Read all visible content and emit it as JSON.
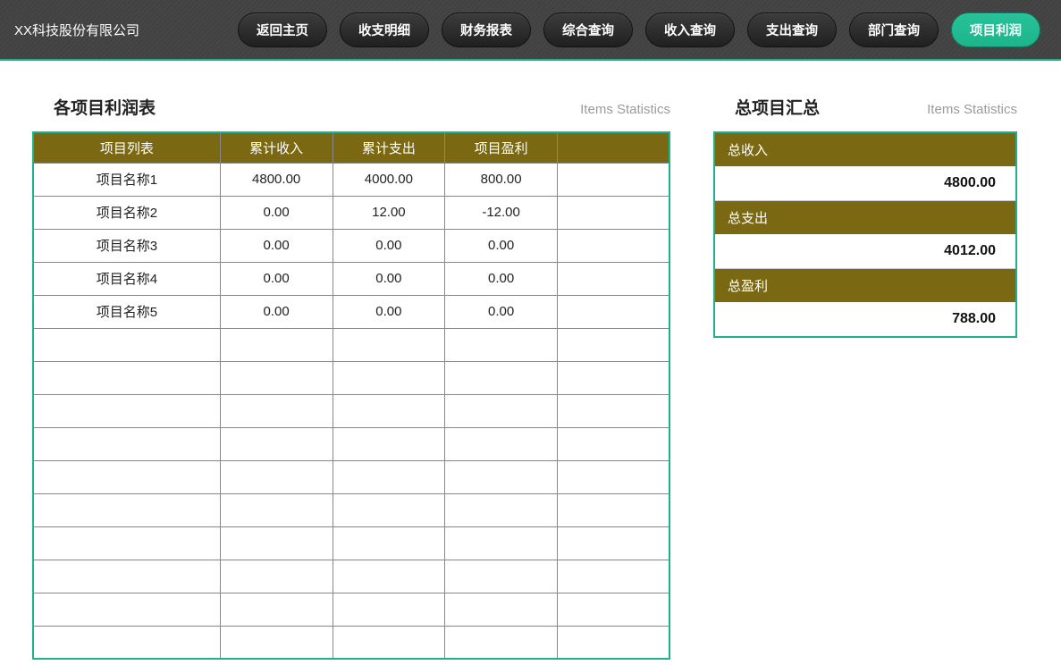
{
  "company_name": "XX科技股份有限公司",
  "nav": {
    "items": [
      "返回主页",
      "收支明细",
      "财务报表",
      "综合查询",
      "收入查询",
      "支出查询",
      "部门查询",
      "项目利润"
    ],
    "active_index": 7
  },
  "left": {
    "title": "各项目利润表",
    "subtitle": "Items Statistics",
    "columns": [
      "项目列表",
      "累计收入",
      "累计支出",
      "项目盈利",
      ""
    ],
    "rows": [
      {
        "name": "项目名称1",
        "income": "4800.00",
        "expense": "4000.00",
        "profit": "800.00"
      },
      {
        "name": "项目名称2",
        "income": "0.00",
        "expense": "12.00",
        "profit": "-12.00"
      },
      {
        "name": "项目名称3",
        "income": "0.00",
        "expense": "0.00",
        "profit": "0.00"
      },
      {
        "name": "项目名称4",
        "income": "0.00",
        "expense": "0.00",
        "profit": "0.00"
      },
      {
        "name": "项目名称5",
        "income": "0.00",
        "expense": "0.00",
        "profit": "0.00"
      }
    ],
    "empty_row_count": 10
  },
  "right": {
    "title": "总项目汇总",
    "subtitle": "Items Statistics",
    "items": [
      {
        "label": "总收入",
        "value": "4800.00"
      },
      {
        "label": "总支出",
        "value": "4012.00"
      },
      {
        "label": "总盈利",
        "value": "788.00"
      }
    ]
  }
}
